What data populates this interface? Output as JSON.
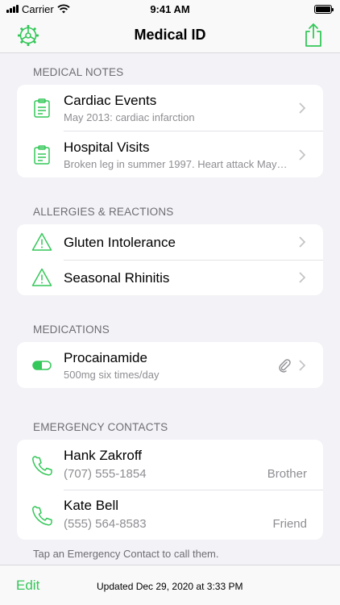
{
  "status_bar": {
    "carrier": "Carrier",
    "time": "9:41 AM"
  },
  "nav": {
    "title": "Medical ID",
    "left_icon": "gear-icon",
    "right_icon": "share-icon"
  },
  "sections": {
    "medical_notes": {
      "header": "MEDICAL NOTES",
      "rows": [
        {
          "title": "Cardiac Events",
          "subtitle": "May 2013: cardiac infarction",
          "icon": "clipboard-icon"
        },
        {
          "title": "Hospital Visits",
          "subtitle": "Broken leg in summer 1997.  Heart attack May…",
          "icon": "clipboard-icon"
        }
      ]
    },
    "allergies": {
      "header": "ALLERGIES & REACTIONS",
      "rows": [
        {
          "title": "Gluten Intolerance",
          "icon": "warning-icon"
        },
        {
          "title": "Seasonal Rhinitis",
          "icon": "warning-icon"
        }
      ]
    },
    "medications": {
      "header": "MEDICATIONS",
      "rows": [
        {
          "title": "Procainamide",
          "subtitle": "500mg six times/day",
          "icon": "pill-icon",
          "attachment_icon": "paperclip-icon"
        }
      ]
    },
    "contacts": {
      "header": "EMERGENCY CONTACTS",
      "rows": [
        {
          "name": "Hank Zakroff",
          "phone": "(707) 555-1854",
          "relation": "Brother",
          "icon": "phone-icon"
        },
        {
          "name": "Kate Bell",
          "phone": "(555) 564-8583",
          "relation": "Friend",
          "icon": "phone-icon"
        }
      ],
      "footer": "Tap an Emergency Contact to call them."
    }
  },
  "bottom_bar": {
    "edit_label": "Edit",
    "updated": "Updated Dec 29, 2020 at 3:33 PM"
  },
  "colors": {
    "accent": "#34c759",
    "secondary_text": "#8e8e93",
    "background": "#f2f2f7"
  }
}
